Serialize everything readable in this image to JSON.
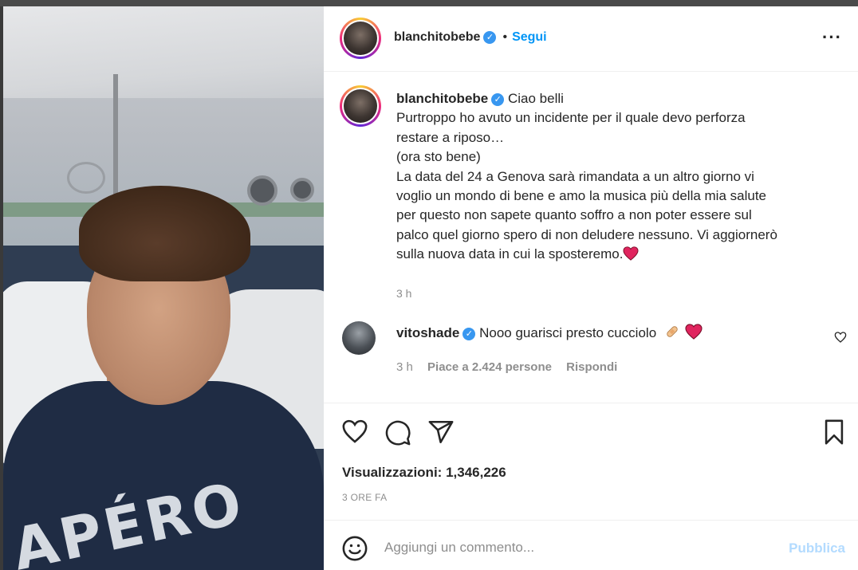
{
  "post": {
    "author": "blanchitobebe",
    "follow_label": "Segui",
    "more_icon": "more-horizontal-icon",
    "dot": "•"
  },
  "caption": {
    "author": "blanchitobebe",
    "lines": [
      "Ciao belli",
      "Purtroppo ho avuto un incidente per il quale devo perforza",
      "restare a riposo…",
      "(ora sto bene)",
      "La data del 24 a Genova sarà rimandata a un altro giorno vi",
      "voglio un mondo di bene e amo la musica più della mia salute",
      "per questo non sapete quanto soffro a non poter essere sul",
      "palco quel giorno spero di non deludere nessuno. Vi aggiornerò",
      "sulla nuova data in cui la sposteremo."
    ],
    "time": "3 h"
  },
  "comment": {
    "author": "vitoshade",
    "text": "Nooo guarisci presto cucciolo",
    "time": "3 h",
    "likes": "Piace a 2.424 persone",
    "reply_label": "Rispondi"
  },
  "stats": {
    "views_label": "Visualizzazioni:",
    "views_value": "1,346,226",
    "posted_ago": "3 ORE FA"
  },
  "add_comment": {
    "placeholder": "Aggiungi un commento...",
    "publish_label": "Pubblica"
  },
  "media": {
    "shirt_text": "APÉRO"
  },
  "colors": {
    "accent": "#0095f6",
    "verified": "#3897f0",
    "muted": "#8e8e8e",
    "text": "#262626",
    "publish_disabled": "#b3dbff",
    "heart_red": "#e0245e"
  }
}
